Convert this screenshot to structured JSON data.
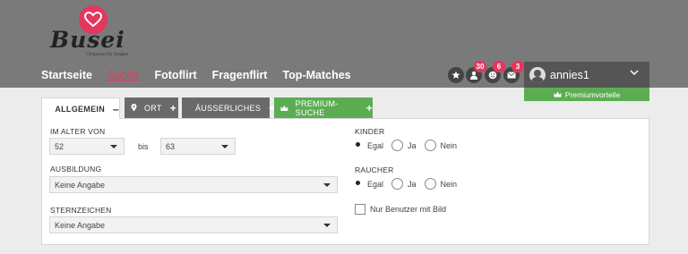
{
  "logo": {
    "text": "Busei",
    "tagline": "Flirtportal für Singles"
  },
  "nav": {
    "items": [
      {
        "label": "Startseite",
        "active": false
      },
      {
        "label": "Suche",
        "active": true
      },
      {
        "label": "Fotoflirt",
        "active": false
      },
      {
        "label": "Fragenflirt",
        "active": false
      },
      {
        "label": "Top-Matches",
        "active": false
      }
    ]
  },
  "header_icons": [
    {
      "icon": "star-icon",
      "badge": ""
    },
    {
      "icon": "visitors-icon",
      "badge": "30"
    },
    {
      "icon": "smiley-icon",
      "badge": "6"
    },
    {
      "icon": "mail-icon",
      "badge": "3"
    }
  ],
  "user": {
    "name": "annies1",
    "premium_label": "Premiumvorteile"
  },
  "tabs": {
    "allgemein": "ALLGEMEIN",
    "ort": "ORT",
    "aeusserliches": "ÄUSSERLICHES",
    "premium": "PREMIUM-SUCHE"
  },
  "form": {
    "age": {
      "label": "IM ALTER VON",
      "from": "52",
      "to_label": "bis",
      "to": "63"
    },
    "ausbildung": {
      "label": "AUSBILDUNG",
      "value": "Keine Angabe"
    },
    "sternzeichen": {
      "label": "STERNZEICHEN",
      "value": "Keine Angabe"
    },
    "kinder": {
      "label": "KINDER",
      "options": [
        "Egal",
        "Ja",
        "Nein"
      ],
      "selected": "Egal"
    },
    "raucher": {
      "label": "RAUCHER",
      "options": [
        "Egal",
        "Ja",
        "Nein"
      ],
      "selected": "Egal"
    },
    "bild_checkbox": {
      "label": "Nur Benutzer mit Bild",
      "checked": false
    }
  },
  "colors": {
    "header": "#7a7a7a",
    "accent": "#e6365c",
    "premium": "#5cad52",
    "tab_dark": "#6a6a6a"
  }
}
